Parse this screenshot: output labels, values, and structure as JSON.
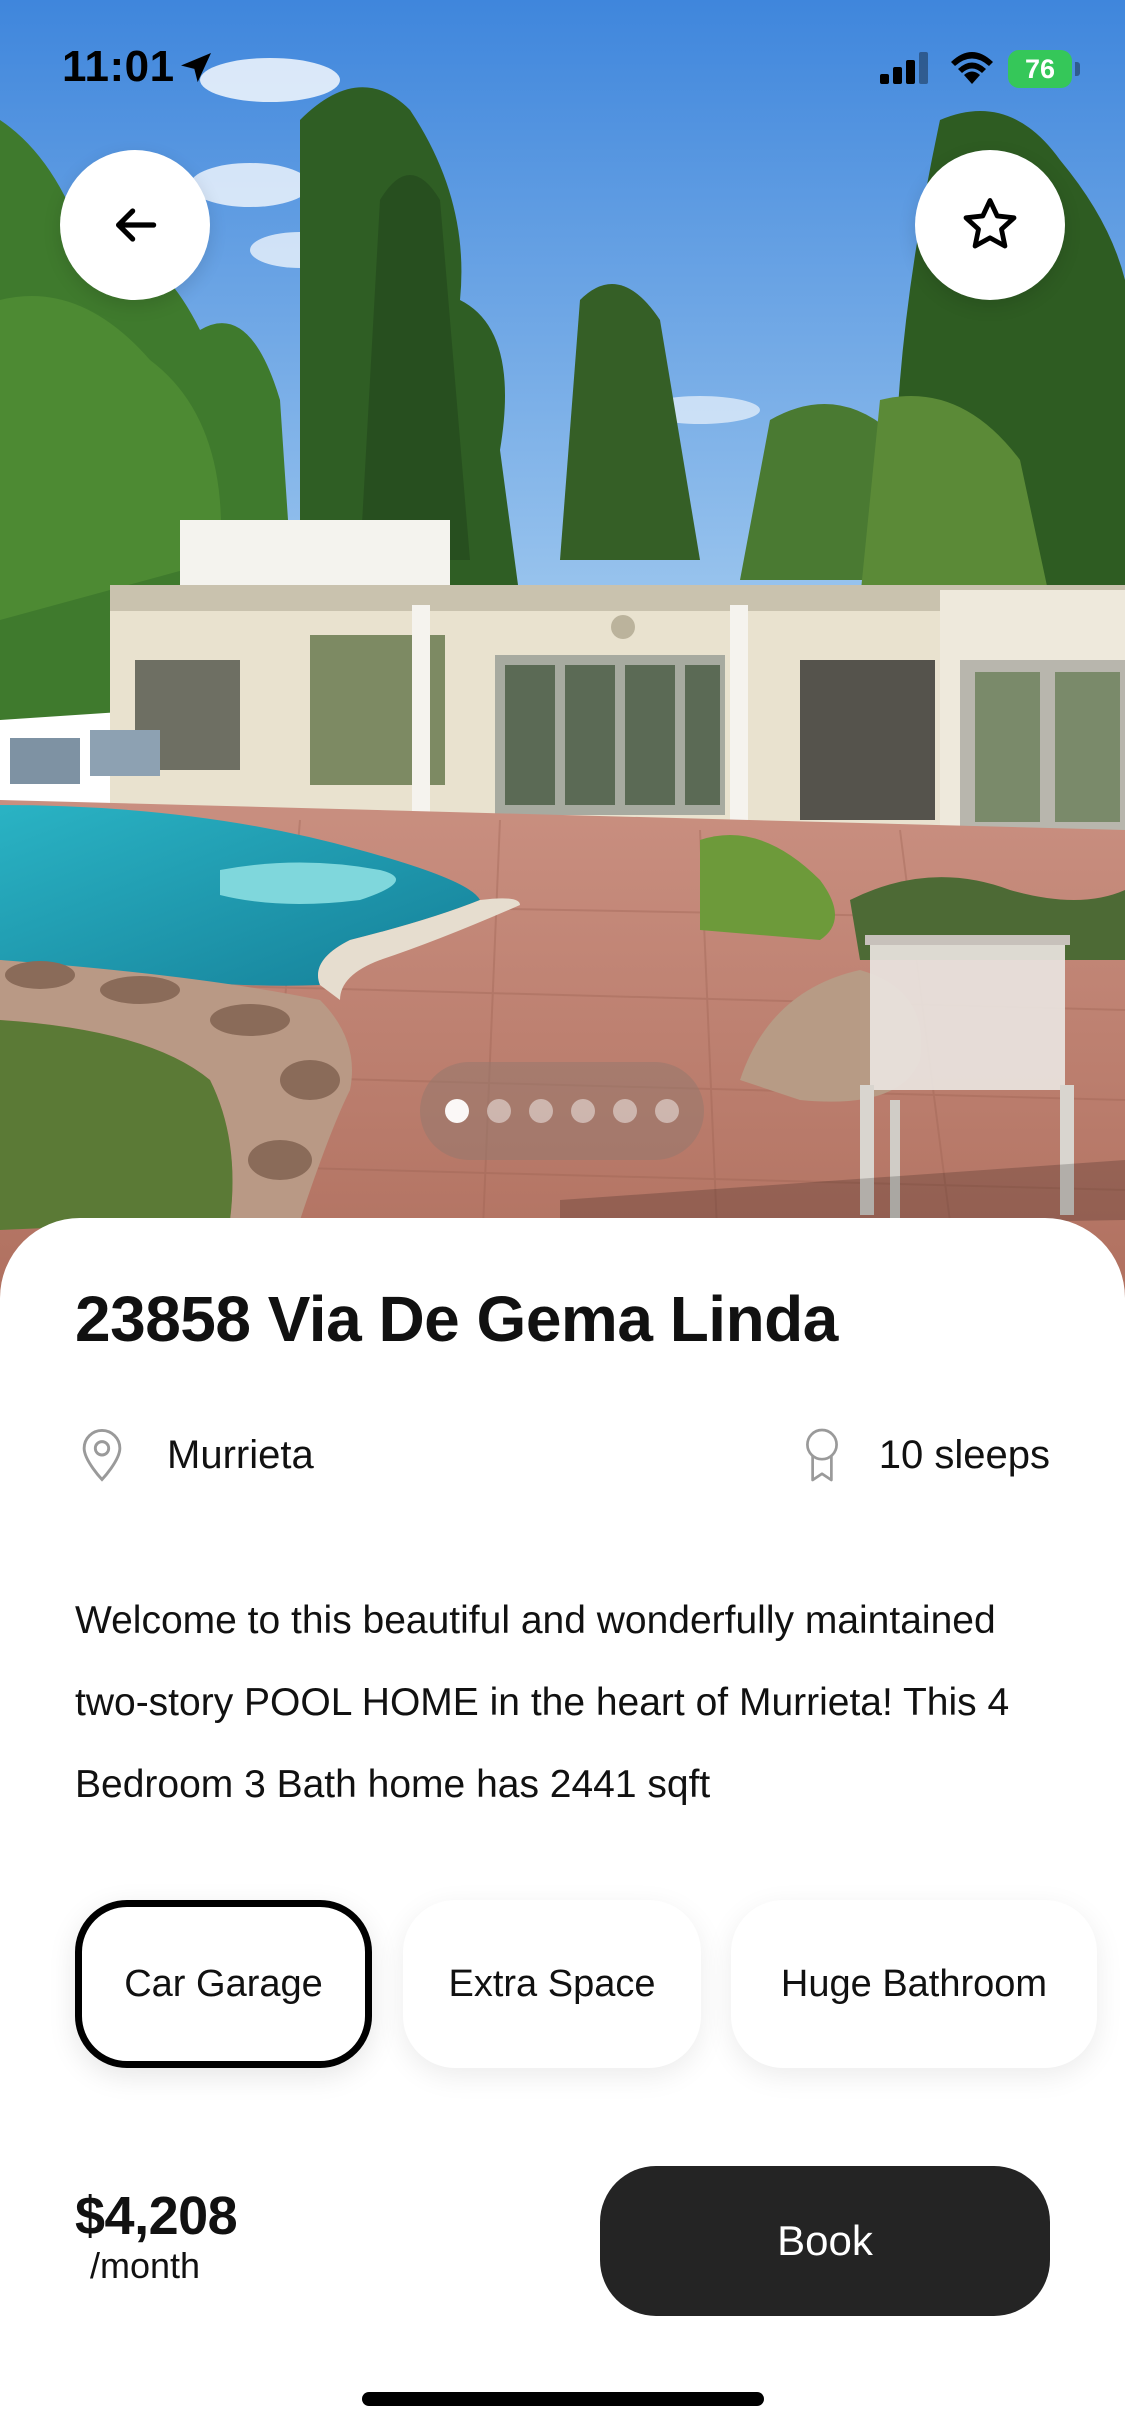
{
  "status_bar": {
    "time": "11:01",
    "battery": "76"
  },
  "hero": {
    "photo_subject": "house-with-pool-photo",
    "carousel": {
      "total": 6,
      "active_index": 0
    }
  },
  "actions": {
    "back_icon": "arrow-left-icon",
    "favorite_icon": "star-outline-icon"
  },
  "listing": {
    "title": "23858 Via De Gema Linda",
    "location_icon": "map-pin-icon",
    "location": "Murrieta",
    "sleeps_icon": "award-ribbon-icon",
    "sleeps": "10 sleeps",
    "description": "Welcome to this beautiful and wonderfully maintained two-story POOL HOME in the heart of Murrieta! This 4 Bedroom 3 Bath home has 2441 sqft",
    "features": [
      {
        "label": "Car Garage",
        "selected": true
      },
      {
        "label": "Extra Space",
        "selected": false
      },
      {
        "label": "Huge Bathroom",
        "selected": false
      }
    ]
  },
  "footer": {
    "price": "$4,208",
    "price_unit": "/month",
    "book_label": "Book"
  },
  "colors": {
    "primary_dark": "#242424",
    "battery_green": "#35c759",
    "sheet_bg": "#ffffff"
  }
}
